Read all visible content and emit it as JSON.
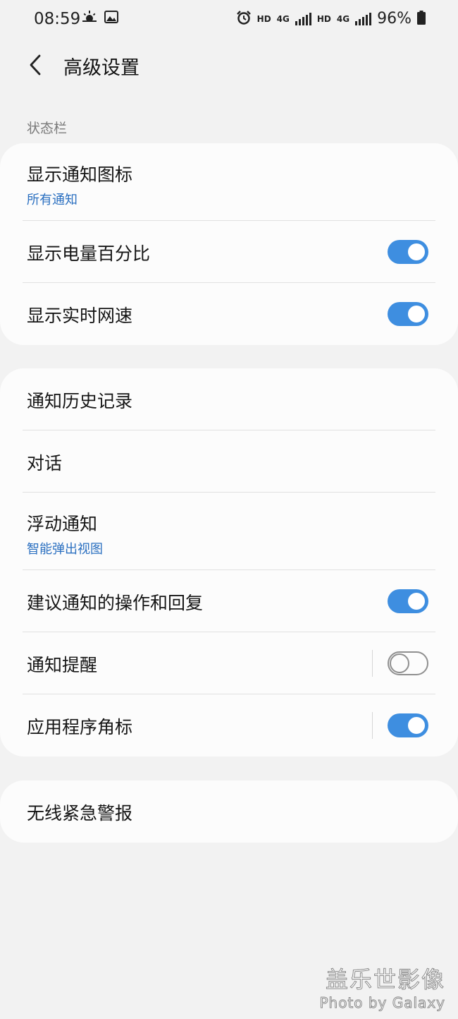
{
  "status_bar": {
    "time": "08:59",
    "left_icons": [
      "weather-icon",
      "image-icon"
    ],
    "right_icons": [
      "alarm-icon",
      "hd-icon",
      "4g-signal-icon",
      "hd-icon",
      "4g-signal-icon",
      "battery-icon"
    ],
    "hd_label": "HD",
    "net_label": "4G",
    "battery_percent": "96%"
  },
  "header": {
    "title": "高级设置",
    "back_icon": "chevron-left-icon"
  },
  "section_status_bar": {
    "label": "状态栏"
  },
  "card1": {
    "rows": [
      {
        "title": "显示通知图标",
        "subtitle": "所有通知"
      },
      {
        "title": "显示电量百分比",
        "toggle_on": true
      },
      {
        "title": "显示实时网速",
        "toggle_on": true
      }
    ]
  },
  "card2": {
    "rows": [
      {
        "title": "通知历史记录"
      },
      {
        "title": "对话"
      },
      {
        "title": "浮动通知",
        "subtitle": "智能弹出视图"
      },
      {
        "title": "建议通知的操作和回复",
        "toggle_on": true
      },
      {
        "title": "通知提醒",
        "toggle_on": false
      },
      {
        "title": "应用程序角标",
        "toggle_on": true
      }
    ]
  },
  "card3": {
    "rows": [
      {
        "title": "无线紧急警报"
      }
    ]
  },
  "watermark": {
    "line1": "盖乐世影像",
    "line2": "Photo by Galaxy"
  },
  "colors": {
    "accent": "#3e8ee0",
    "subtitle": "#2a6fc0",
    "background": "#f2f2f2",
    "card": "#fcfcfc"
  }
}
